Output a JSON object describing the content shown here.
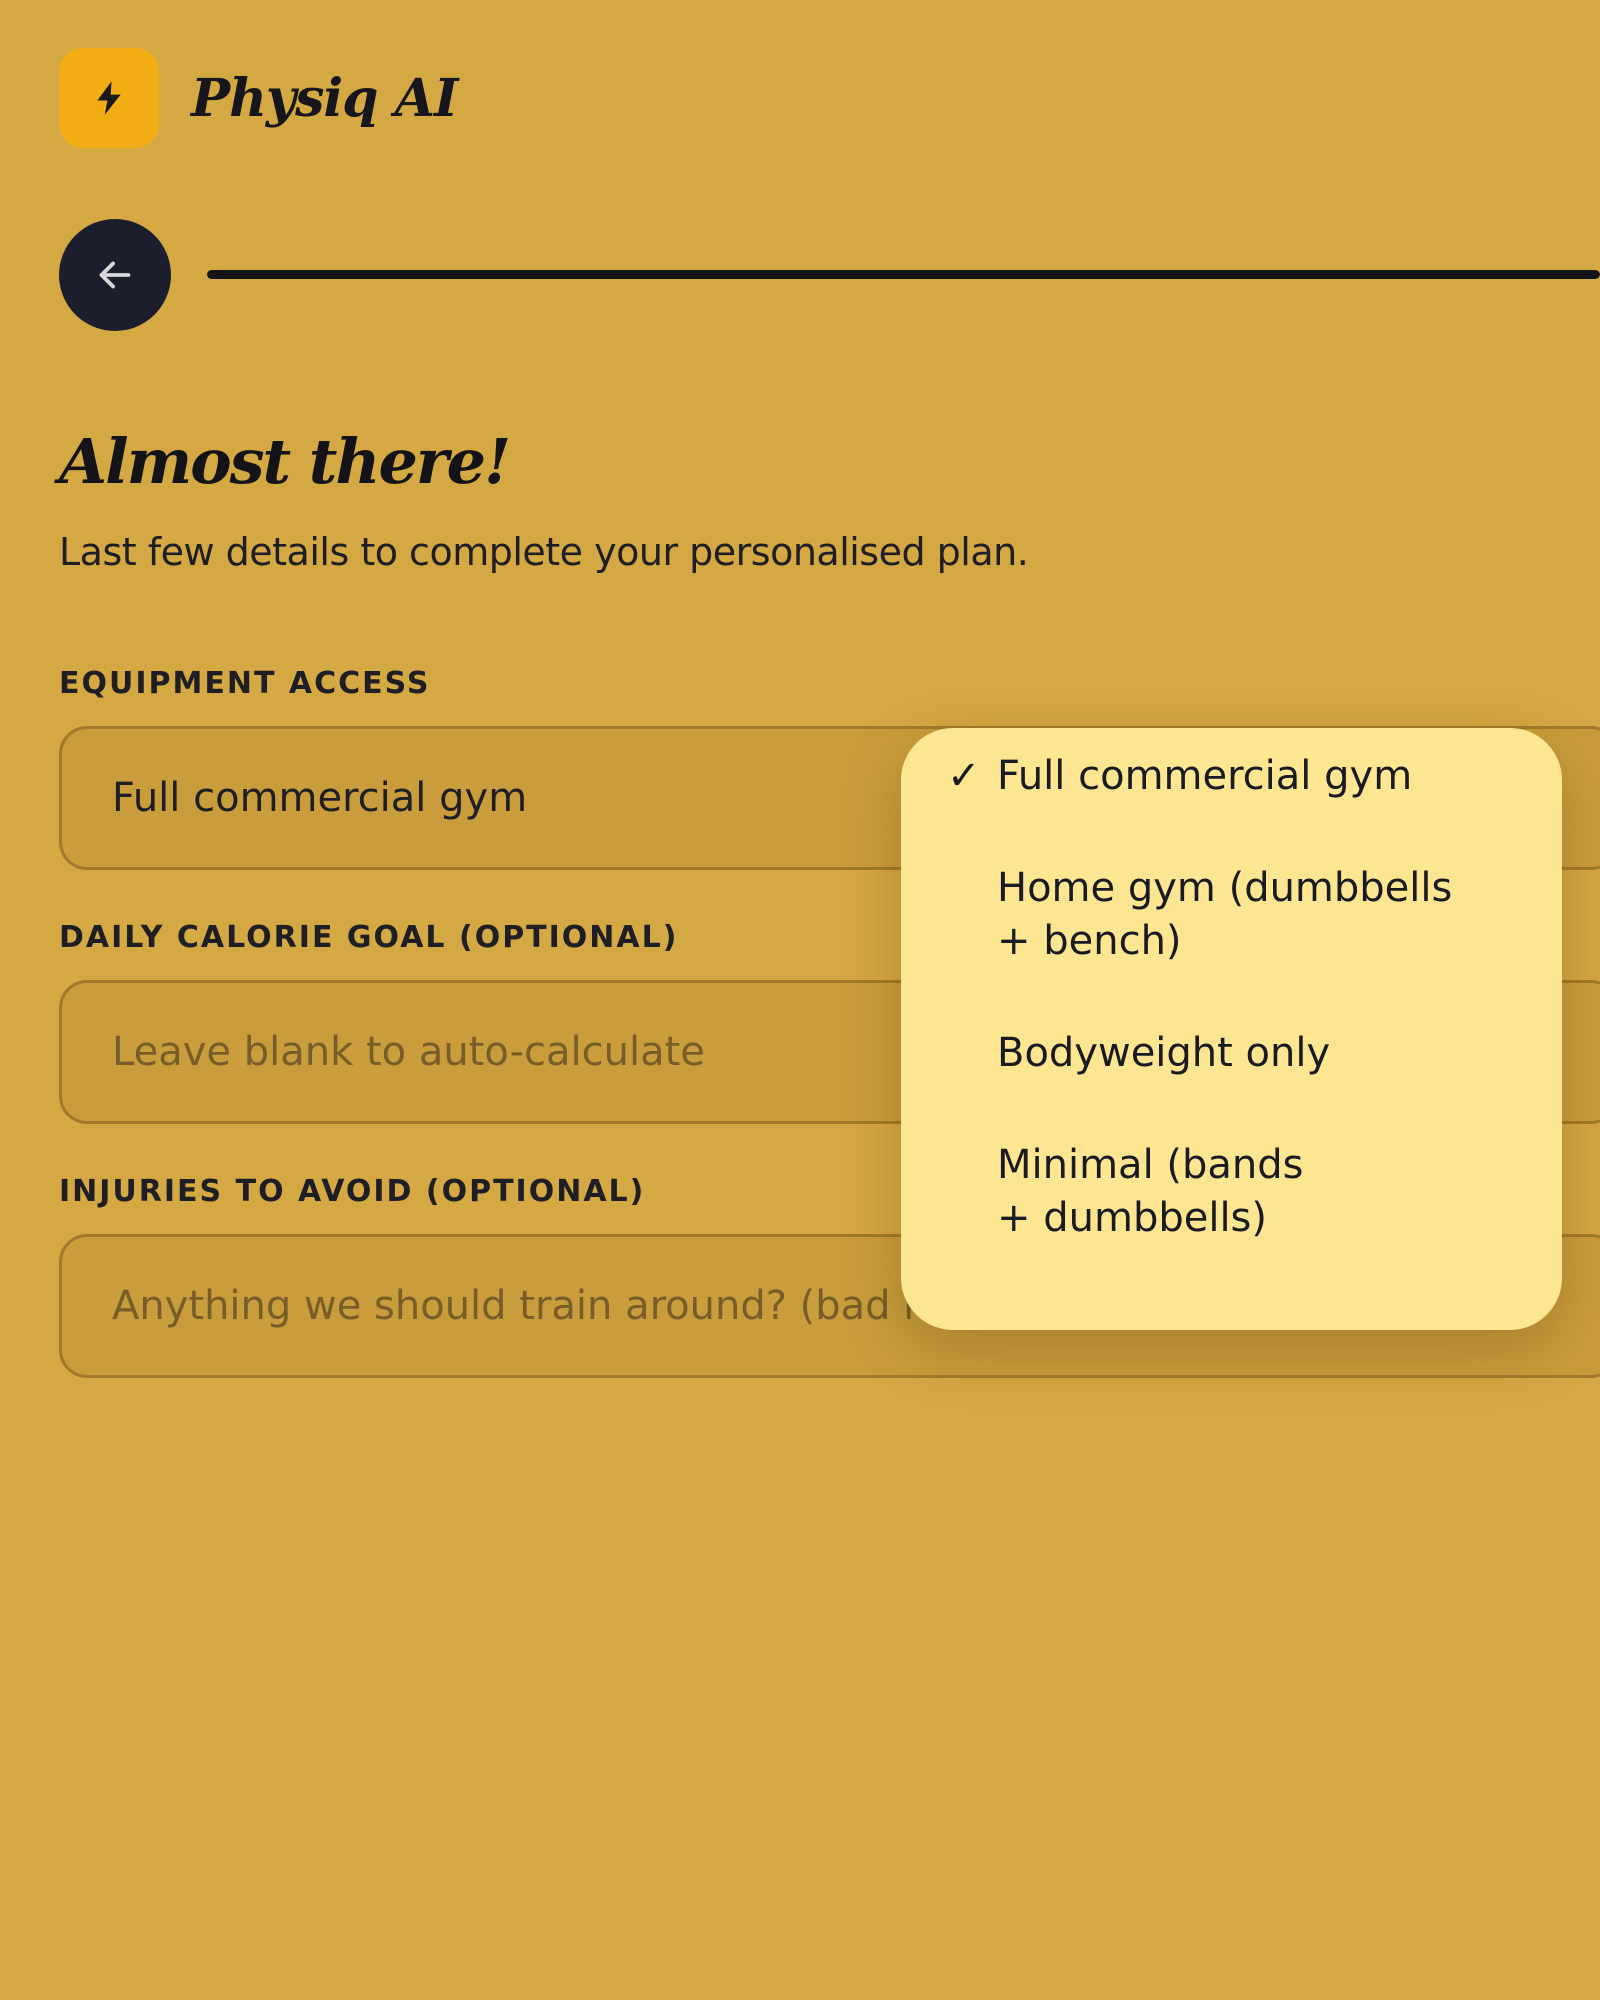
{
  "app": {
    "brand": "Physiq AI",
    "logo_icon": "lightning-bolt-icon",
    "accent_color": "#f2ad14",
    "background_color": "#d4a843"
  },
  "progress": {
    "fraction": 1.0
  },
  "page": {
    "title": "Almost there!",
    "subtitle": "Last few details to complete your personalised plan."
  },
  "form": {
    "equipment": {
      "label": "EQUIPMENT ACCESS",
      "value": "Full commercial gym",
      "options": [
        {
          "label": "Full commercial gym",
          "selected": true
        },
        {
          "label": "Home gym (dumbbells\n+ bench)",
          "selected": false
        },
        {
          "label": "Bodyweight only",
          "selected": false
        },
        {
          "label": "Minimal (bands\n+ dumbbells)",
          "selected": false
        }
      ],
      "check_mark": "✓"
    },
    "calories": {
      "label": "DAILY CALORIE GOAL (OPTIONAL)",
      "placeholder": "Leave blank to auto-calculate"
    },
    "injuries": {
      "label": "INJURIES TO AVOID (OPTIONAL)",
      "placeholder": "Anything we should train around? (bad knees, etc.)"
    }
  }
}
